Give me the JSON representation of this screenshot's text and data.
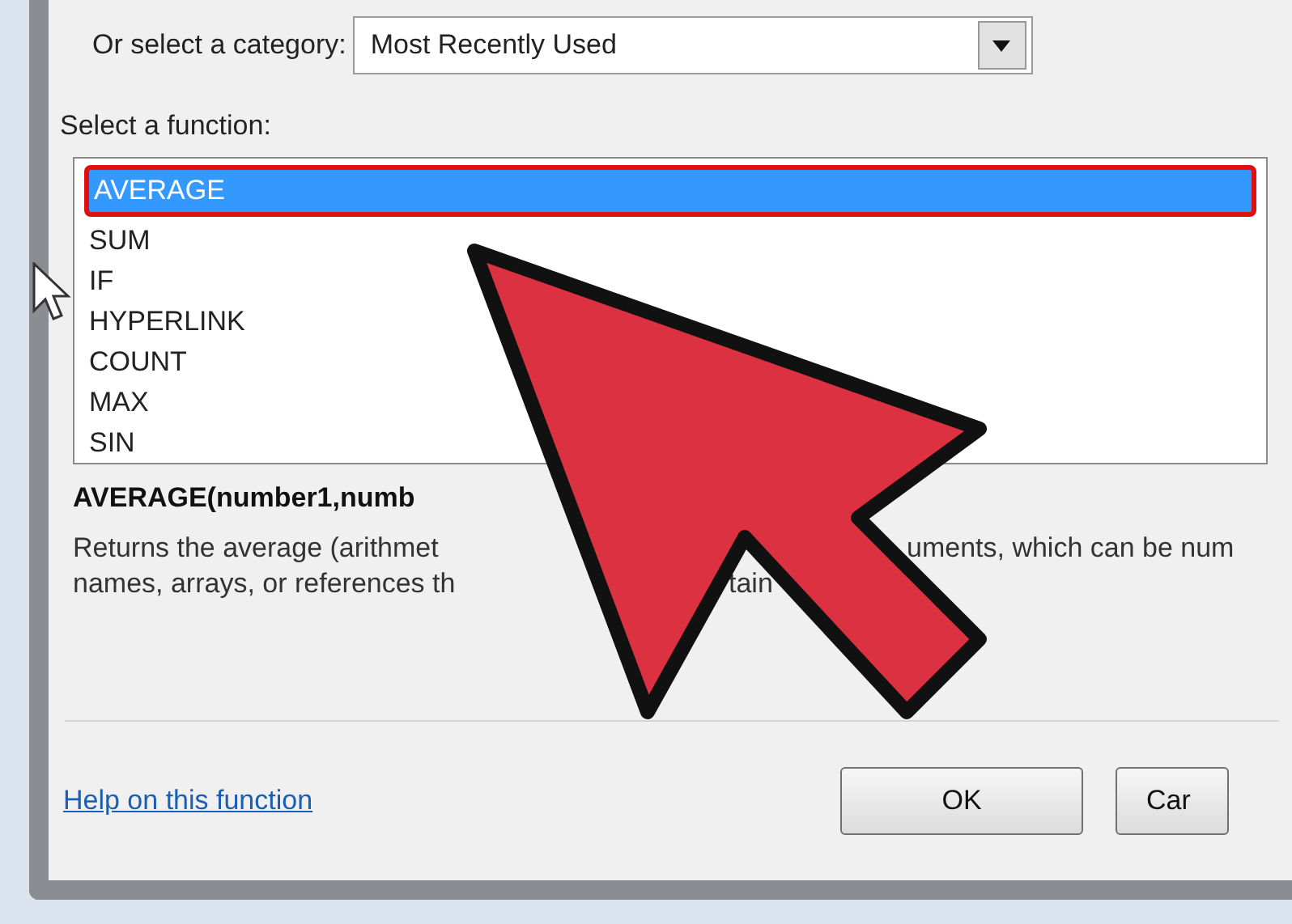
{
  "category": {
    "label": "Or select a category:",
    "value": "Most Recently Used"
  },
  "function_list": {
    "label": "Select a function:",
    "items": [
      {
        "label": "AVERAGE",
        "selected": true
      },
      {
        "label": "SUM",
        "selected": false
      },
      {
        "label": "IF",
        "selected": false
      },
      {
        "label": "HYPERLINK",
        "selected": false
      },
      {
        "label": "COUNT",
        "selected": false
      },
      {
        "label": "MAX",
        "selected": false
      },
      {
        "label": "SIN",
        "selected": false
      }
    ]
  },
  "signature": "AVERAGE(number1,numb",
  "description_lines": [
    {
      "left": "Returns the average (arithmet",
      "right": "uments, which can be num"
    },
    {
      "left": "names, arrays, or references th",
      "right": "tain"
    }
  ],
  "help_link": "Help on this function",
  "buttons": [
    "OK",
    "Car"
  ]
}
